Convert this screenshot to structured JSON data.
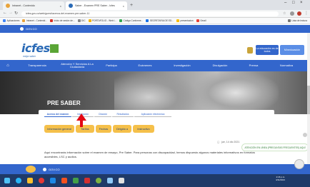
{
  "browser": {
    "tabs": [
      {
        "label": "Intranet - Contenido",
        "color": "#e8a33b"
      },
      {
        "label": "Saber - Examen PRE Saber - Icfes",
        "color": "#2a6ab6"
      }
    ],
    "url": "icfes.gov.co/web/guest/acerca-del-examen-pre-saber-11",
    "bookmarks": [
      "Aplicaciones",
      "Intranet - Contenid...",
      "Inicio de sesión de...",
      "DIC",
      "PORTAFOLIO - Web I...",
      "Código Conforme...",
      "SECRETARIA DE ED...",
      "presentacion",
      "Gmail"
    ],
    "bookmarks_other": "Lista de lectura",
    "window_controls": [
      "–",
      "□",
      "×"
    ]
  },
  "gov_bar": {
    "label": "GOV.CO"
  },
  "header": {
    "logo_text": "icfes",
    "logo_sub": "mejor saber",
    "btn_education": "La educación es de todos",
    "btn_mineducacion": "Mineducación"
  },
  "nav": {
    "items": [
      "Transparencia",
      "Atención Y Servicios A La Ciudadanía",
      "Participa",
      "Exámenes",
      "Investigación",
      "Divulgación",
      "Prensa",
      "Normativa"
    ]
  },
  "hero": {
    "title": "PRE SABER"
  },
  "subtabs": [
    "Acerca del examen",
    "Inscripción",
    "Citación",
    "Resultados",
    "Aplicación electrónica"
  ],
  "buttons": [
    "Información general",
    "Tarifas",
    "Fechas",
    "Dirigido a",
    "Instructivo"
  ],
  "date": "jue, 14 dic 2021",
  "paragraph": "Aquí encontrarás información sobre el examen de ensayo, Pre Saber. Para personas con discapacidad, hemos dispuesto algunos materiales informativos en formatos accesibles, LSC y audios.",
  "side_pill": "ATENCIÓN EN LÍNEA (PREGUNTAS FRECUENTES) AQUÍ",
  "footer": {
    "label": "GOV.CO"
  },
  "tray": {
    "time": "2:16 p.m.",
    "date": "4/11/2021"
  }
}
